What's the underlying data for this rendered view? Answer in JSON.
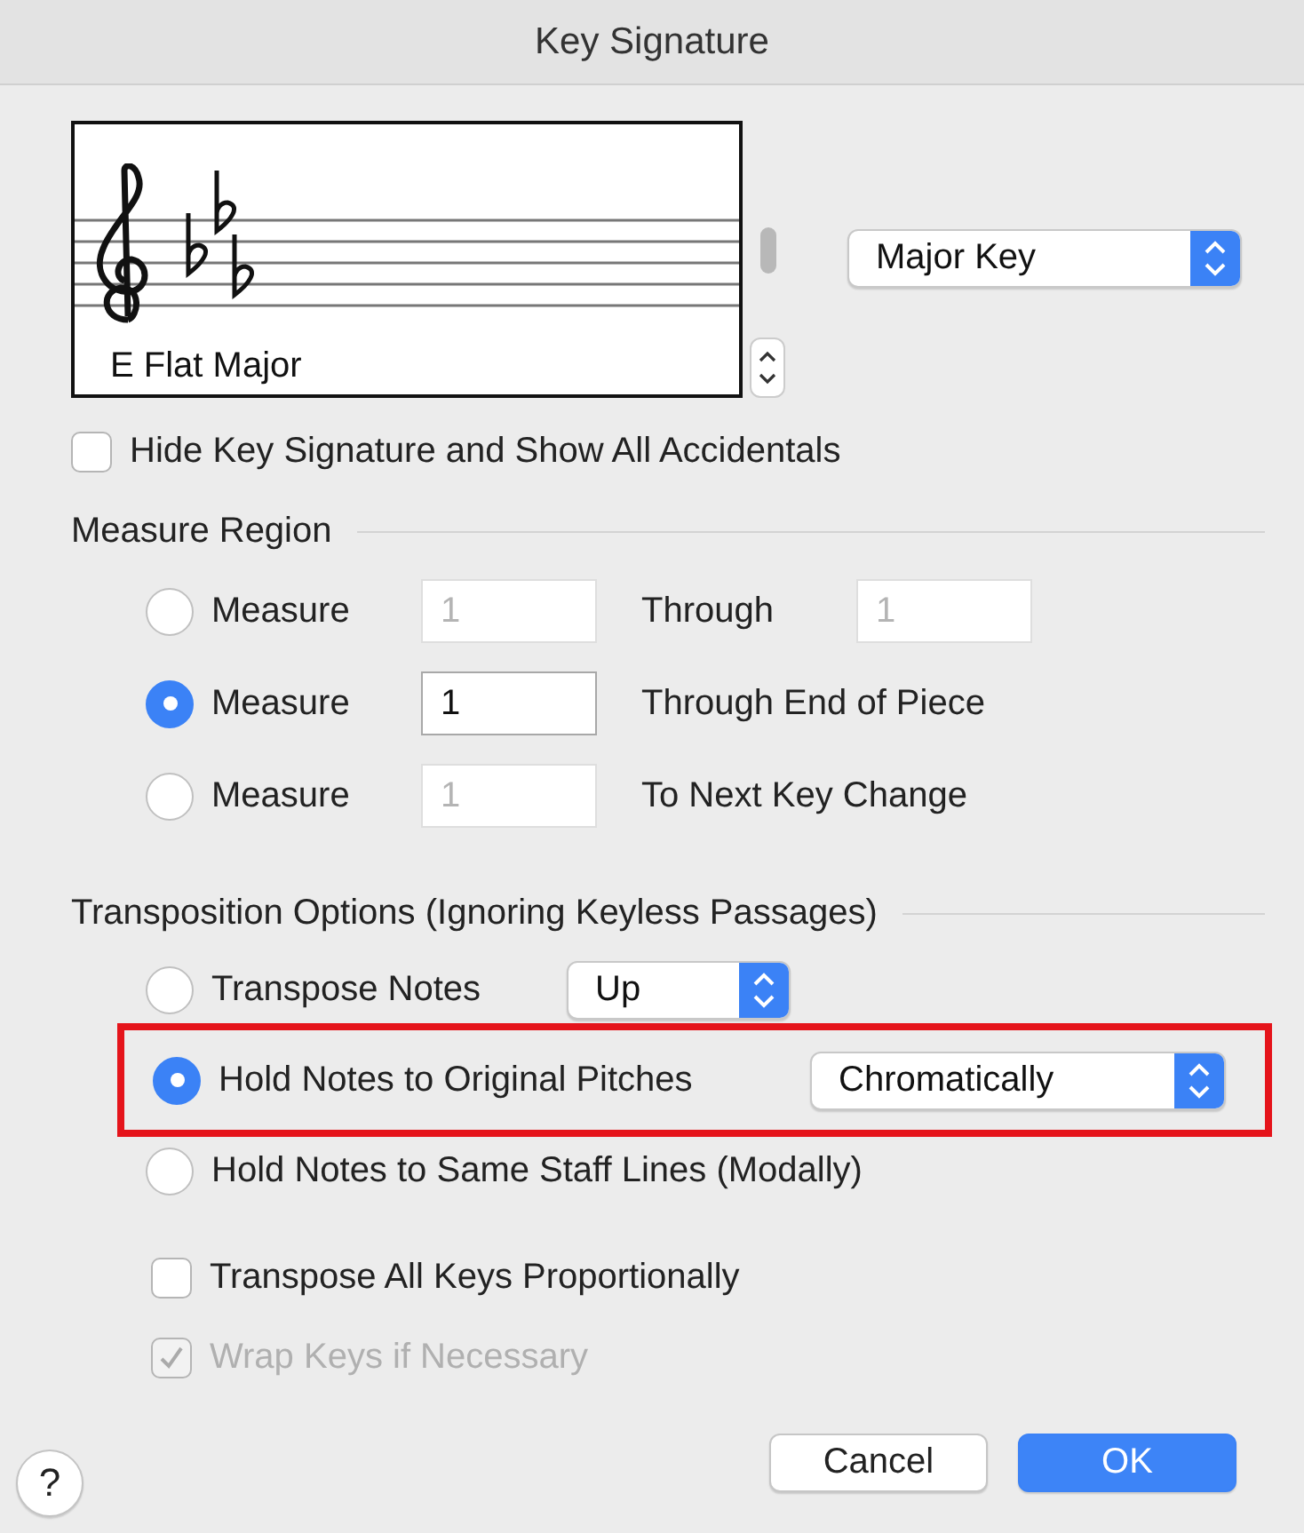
{
  "window": {
    "title": "Key Signature"
  },
  "preview": {
    "caption": "E Flat Major"
  },
  "key_mode": {
    "value": "Major Key"
  },
  "hide_key_signature": {
    "label": "Hide Key Signature and Show All Accidentals",
    "checked": false
  },
  "measure_region": {
    "heading": "Measure Region",
    "options": [
      {
        "label": "Measure",
        "selected": false,
        "start": {
          "value": "1",
          "disabled": true
        },
        "end_label": "Through",
        "end": {
          "value": "1",
          "disabled": true
        }
      },
      {
        "label": "Measure",
        "selected": true,
        "start": {
          "value": "1",
          "disabled": false
        },
        "end_label": "Through End of Piece"
      },
      {
        "label": "Measure",
        "selected": false,
        "start": {
          "value": "1",
          "disabled": true
        },
        "end_label": "To Next Key Change"
      }
    ]
  },
  "transposition": {
    "heading": "Transposition Options (Ignoring Keyless Passages)",
    "options": [
      {
        "label": "Transpose Notes",
        "selected": false,
        "popup": "Up",
        "highlighted": false
      },
      {
        "label": "Hold Notes to Original Pitches",
        "selected": true,
        "popup": "Chromatically",
        "highlighted": true
      },
      {
        "label": "Hold Notes to Same Staff Lines (Modally)",
        "selected": false,
        "highlighted": false
      }
    ],
    "checkboxes": [
      {
        "label": "Transpose All Keys Proportionally",
        "checked": false,
        "disabled": false
      },
      {
        "label": "Wrap Keys if Necessary",
        "checked": true,
        "disabled": true
      }
    ]
  },
  "help": {
    "label": "?"
  },
  "buttons": [
    {
      "label": "Cancel",
      "default": false
    },
    {
      "label": "OK",
      "default": true
    }
  ]
}
